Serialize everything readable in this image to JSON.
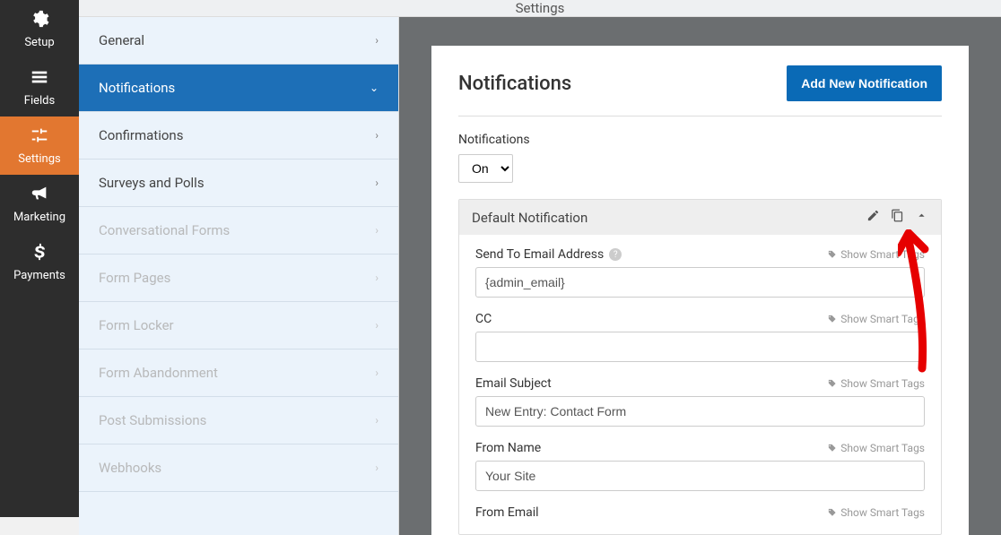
{
  "top_title": "Settings",
  "sidebar": {
    "items": [
      {
        "label": "Setup",
        "icon": "gear"
      },
      {
        "label": "Fields",
        "icon": "list"
      },
      {
        "label": "Settings",
        "icon": "sliders",
        "active": true
      },
      {
        "label": "Marketing",
        "icon": "bullhorn"
      },
      {
        "label": "Payments",
        "icon": "dollar"
      }
    ]
  },
  "submenu": {
    "items": [
      {
        "label": "General",
        "kind": "forward"
      },
      {
        "label": "Notifications",
        "kind": "expanded",
        "active": true
      },
      {
        "label": "Confirmations",
        "kind": "forward"
      },
      {
        "label": "Surveys and Polls",
        "kind": "forward"
      },
      {
        "label": "Conversational Forms",
        "kind": "forward",
        "disabled": true
      },
      {
        "label": "Form Pages",
        "kind": "forward",
        "disabled": true
      },
      {
        "label": "Form Locker",
        "kind": "forward",
        "disabled": true
      },
      {
        "label": "Form Abandonment",
        "kind": "forward",
        "disabled": true
      },
      {
        "label": "Post Submissions",
        "kind": "forward",
        "disabled": true
      },
      {
        "label": "Webhooks",
        "kind": "forward",
        "disabled": true
      }
    ]
  },
  "panel": {
    "title": "Notifications",
    "add_button": "Add New Notification",
    "toggle_label": "Notifications",
    "toggle_value": "On",
    "card_title": "Default Notification",
    "smart_tags_label": "Show Smart Tags",
    "fields": [
      {
        "label": "Send To Email Address",
        "help": true,
        "value": "{admin_email}"
      },
      {
        "label": "CC",
        "value": ""
      },
      {
        "label": "Email Subject",
        "value": "New Entry: Contact Form"
      },
      {
        "label": "From Name",
        "value": "Your Site"
      },
      {
        "label": "From Email",
        "value": ""
      }
    ]
  }
}
